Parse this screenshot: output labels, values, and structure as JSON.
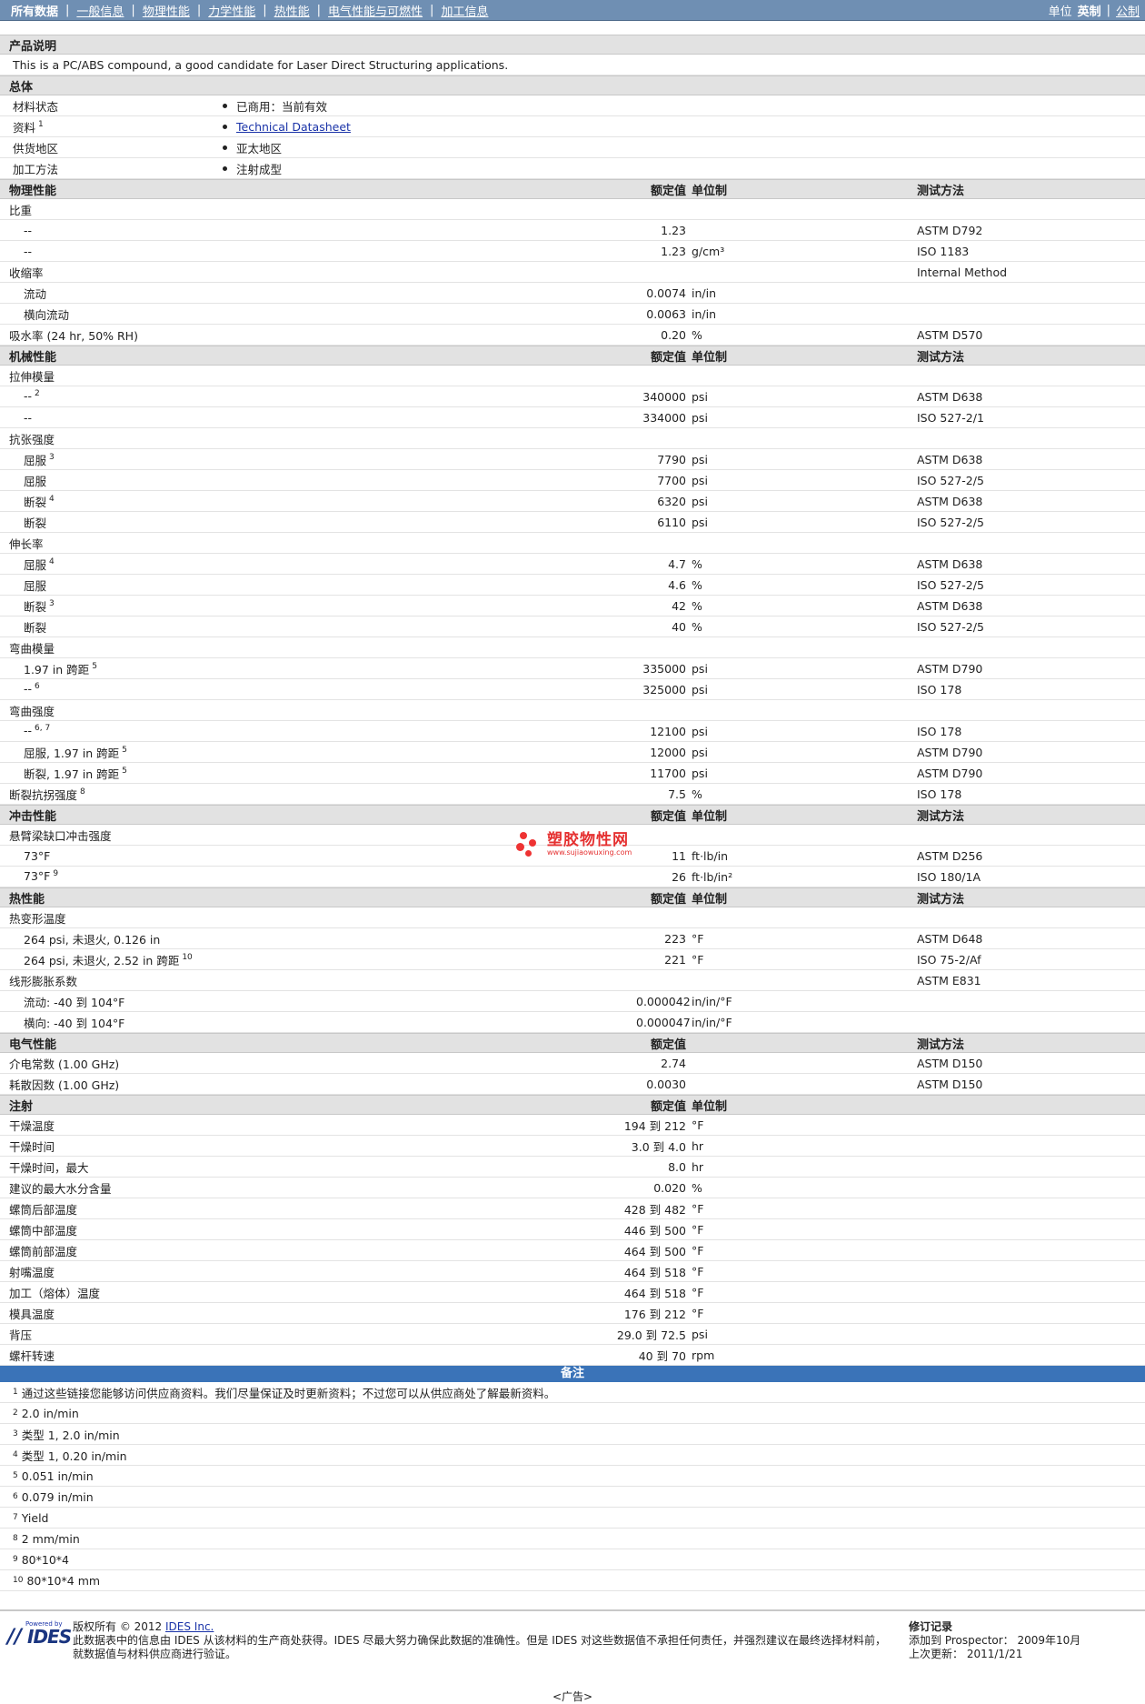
{
  "nav": {
    "items": [
      "所有数据",
      "一般信息",
      "物理性能",
      "力学性能",
      "热性能",
      "电气性能与可燃性",
      "加工信息"
    ],
    "unit_label": "单位",
    "unit_english": "英制",
    "unit_metric": "公制"
  },
  "columns": {
    "value": "额定值",
    "unit": "单位制",
    "method": "测试方法"
  },
  "product": {
    "title": "产品说明",
    "description": "This is a PC/ABS compound, a good candidate for Laser Direct Structuring applications."
  },
  "general": {
    "title": "总体",
    "rows": [
      {
        "label": "材料状态",
        "value": "已商用：当前有效",
        "sup": "",
        "link": false
      },
      {
        "label": "资料",
        "value": "Technical Datasheet",
        "sup": "1",
        "link": true
      },
      {
        "label": "供货地区",
        "value": "亚太地区",
        "sup": "",
        "link": false
      },
      {
        "label": "加工方法",
        "value": "注射成型",
        "sup": "",
        "link": false
      }
    ]
  },
  "physical": {
    "title": "物理性能",
    "rows": [
      {
        "name": "比重",
        "sup": "",
        "indent": false,
        "value": "",
        "unit": "",
        "method": ""
      },
      {
        "name": "--",
        "sup": "",
        "indent": true,
        "value": "1.23",
        "unit": "",
        "method": "ASTM D792"
      },
      {
        "name": "--",
        "sup": "",
        "indent": true,
        "value": "1.23",
        "unit": "g/cm³",
        "method": "ISO 1183"
      },
      {
        "name": "收缩率",
        "sup": "",
        "indent": false,
        "value": "",
        "unit": "",
        "method": "Internal Method"
      },
      {
        "name": "流动",
        "sup": "",
        "indent": true,
        "value": "0.0074",
        "unit": "in/in",
        "method": ""
      },
      {
        "name": "横向流动",
        "sup": "",
        "indent": true,
        "value": "0.0063",
        "unit": "in/in",
        "method": ""
      },
      {
        "name": "吸水率  (24 hr, 50% RH)",
        "sup": "",
        "indent": false,
        "value": "0.20",
        "unit": "%",
        "method": "ASTM D570"
      }
    ]
  },
  "mechanical": {
    "title": "机械性能",
    "rows": [
      {
        "name": "拉伸模量",
        "sup": "",
        "indent": false,
        "value": "",
        "unit": "",
        "method": ""
      },
      {
        "name": "--",
        "sup": "2",
        "indent": true,
        "value": "340000",
        "unit": "psi",
        "method": "ASTM D638"
      },
      {
        "name": "--",
        "sup": "",
        "indent": true,
        "value": "334000",
        "unit": "psi",
        "method": "ISO 527-2/1"
      },
      {
        "name": "抗张强度",
        "sup": "",
        "indent": false,
        "value": "",
        "unit": "",
        "method": ""
      },
      {
        "name": "屈服",
        "sup": "3",
        "indent": true,
        "value": "7790",
        "unit": "psi",
        "method": "ASTM D638"
      },
      {
        "name": "屈服",
        "sup": "",
        "indent": true,
        "value": "7700",
        "unit": "psi",
        "method": "ISO 527-2/5"
      },
      {
        "name": "断裂",
        "sup": "4",
        "indent": true,
        "value": "6320",
        "unit": "psi",
        "method": "ASTM D638"
      },
      {
        "name": "断裂",
        "sup": "",
        "indent": true,
        "value": "6110",
        "unit": "psi",
        "method": "ISO 527-2/5"
      },
      {
        "name": "伸长率",
        "sup": "",
        "indent": false,
        "value": "",
        "unit": "",
        "method": ""
      },
      {
        "name": "屈服",
        "sup": "4",
        "indent": true,
        "value": "4.7",
        "unit": "%",
        "method": "ASTM D638"
      },
      {
        "name": "屈服",
        "sup": "",
        "indent": true,
        "value": "4.6",
        "unit": "%",
        "method": "ISO 527-2/5"
      },
      {
        "name": "断裂",
        "sup": "3",
        "indent": true,
        "value": "42",
        "unit": "%",
        "method": "ASTM D638"
      },
      {
        "name": "断裂",
        "sup": "",
        "indent": true,
        "value": "40",
        "unit": "%",
        "method": "ISO 527-2/5"
      },
      {
        "name": "弯曲模量",
        "sup": "",
        "indent": false,
        "value": "",
        "unit": "",
        "method": ""
      },
      {
        "name": "1.97 in 跨距",
        "sup": "5",
        "indent": true,
        "value": "335000",
        "unit": "psi",
        "method": "ASTM D790"
      },
      {
        "name": "--",
        "sup": "6",
        "indent": true,
        "value": "325000",
        "unit": "psi",
        "method": "ISO 178"
      },
      {
        "name": "弯曲强度",
        "sup": "",
        "indent": false,
        "value": "",
        "unit": "",
        "method": ""
      },
      {
        "name": "--",
        "sup": "6, 7",
        "indent": true,
        "value": "12100",
        "unit": "psi",
        "method": "ISO 178"
      },
      {
        "name": "屈服, 1.97 in 跨距",
        "sup": "5",
        "indent": true,
        "value": "12000",
        "unit": "psi",
        "method": "ASTM D790"
      },
      {
        "name": "断裂, 1.97 in 跨距",
        "sup": "5",
        "indent": true,
        "value": "11700",
        "unit": "psi",
        "method": "ASTM D790"
      },
      {
        "name": "断裂抗拐强度",
        "sup": "8",
        "indent": false,
        "value": "7.5",
        "unit": "%",
        "method": "ISO 178"
      }
    ]
  },
  "impact": {
    "title": "冲击性能",
    "rows": [
      {
        "name": "悬臂梁缺口冲击强度",
        "sup": "",
        "indent": false,
        "value": "",
        "unit": "",
        "method": ""
      },
      {
        "name": "73°F",
        "sup": "",
        "indent": true,
        "value": "11",
        "unit": "ft·lb/in",
        "method": "ASTM D256"
      },
      {
        "name": "73°F",
        "sup": "9",
        "indent": true,
        "value": "26",
        "unit": "ft·lb/in²",
        "method": "ISO 180/1A"
      }
    ]
  },
  "thermal": {
    "title": "热性能",
    "rows": [
      {
        "name": "热变形温度",
        "sup": "",
        "indent": false,
        "value": "",
        "unit": "",
        "method": ""
      },
      {
        "name": "264 psi, 未退火, 0.126 in",
        "sup": "",
        "indent": true,
        "value": "223",
        "unit": "°F",
        "method": "ASTM D648"
      },
      {
        "name": "264 psi, 未退火, 2.52 in 跨距",
        "sup": "10",
        "indent": true,
        "value": "221",
        "unit": "°F",
        "method": "ISO 75-2/Af"
      },
      {
        "name": "线形膨胀系数",
        "sup": "",
        "indent": false,
        "value": "",
        "unit": "",
        "method": "ASTM E831"
      },
      {
        "name": "流动: -40 到  104°F",
        "sup": "",
        "indent": true,
        "value": "0.000042",
        "unit": "in/in/°F",
        "method": ""
      },
      {
        "name": "横向: -40 到  104°F",
        "sup": "",
        "indent": true,
        "value": "0.000047",
        "unit": "in/in/°F",
        "method": ""
      }
    ]
  },
  "electrical": {
    "title": "电气性能",
    "rows": [
      {
        "name": "介电常数  (1.00 GHz)",
        "sup": "",
        "indent": false,
        "value": "2.74",
        "unit": "",
        "method": "ASTM D150"
      },
      {
        "name": "耗散因数  (1.00 GHz)",
        "sup": "",
        "indent": false,
        "value": "0.0030",
        "unit": "",
        "method": "ASTM D150"
      }
    ]
  },
  "injection": {
    "title": "注射",
    "rows": [
      {
        "name": "干燥温度",
        "value": "194 到  212",
        "unit": "°F"
      },
      {
        "name": "干燥时间",
        "value": "3.0 到  4.0",
        "unit": "hr"
      },
      {
        "name": "干燥时间，最大",
        "value": "8.0",
        "unit": "hr"
      },
      {
        "name": "建议的最大水分含量",
        "value": "0.020",
        "unit": "%"
      },
      {
        "name": "螺筒后部温度",
        "value": "428 到  482",
        "unit": "°F"
      },
      {
        "name": "螺筒中部温度",
        "value": "446 到  500",
        "unit": "°F"
      },
      {
        "name": "螺筒前部温度",
        "value": "464 到  500",
        "unit": "°F"
      },
      {
        "name": "射嘴温度",
        "value": "464 到  518",
        "unit": "°F"
      },
      {
        "name": "加工（熔体）温度",
        "value": "464 到  518",
        "unit": "°F"
      },
      {
        "name": "模具温度",
        "value": "176 到  212",
        "unit": "°F"
      },
      {
        "name": "背压",
        "value": "29.0 到  72.5",
        "unit": "psi"
      },
      {
        "name": "螺杆转速",
        "value": "40 到  70",
        "unit": "rpm"
      }
    ]
  },
  "notes": {
    "title": "备注",
    "items": [
      {
        "num": "1",
        "text": "通过这些链接您能够访问供应商资料。我们尽量保证及时更新资料；不过您可以从供应商处了解最新资料。"
      },
      {
        "num": "2",
        "text": "2.0 in/min"
      },
      {
        "num": "3",
        "text": "类型  1, 2.0 in/min"
      },
      {
        "num": "4",
        "text": "类型  1, 0.20 in/min"
      },
      {
        "num": "5",
        "text": "0.051 in/min"
      },
      {
        "num": "6",
        "text": "0.079 in/min"
      },
      {
        "num": "7",
        "text": "Yield"
      },
      {
        "num": "8",
        "text": "2 mm/min"
      },
      {
        "num": "9",
        "text": "80*10*4"
      },
      {
        "num": "10",
        "text": "80*10*4 mm"
      }
    ]
  },
  "footer": {
    "powered_by": "Powered by",
    "logo_text": "IDES",
    "copyright_prefix": "版权所有  © 2012",
    "copyright_link": "IDES Inc.",
    "disclaimer": "此数据表中的信息由  IDES 从该材料的生产商处获得。IDES 尽最大努力确保此数据的准确性。但是  IDES 对这些数据值不承担任何责任，并强烈建议在最终选择材料前，就数据值与材料供应商进行验证。",
    "revision_title": "修订记录",
    "added": "添加到  Prospector：  2009年10月",
    "updated": "上次更新：  2011/1/21",
    "ad": "<广告>"
  },
  "watermark": {
    "cn": "塑胶物性网",
    "en": "www.sujiaowuxing.com"
  }
}
